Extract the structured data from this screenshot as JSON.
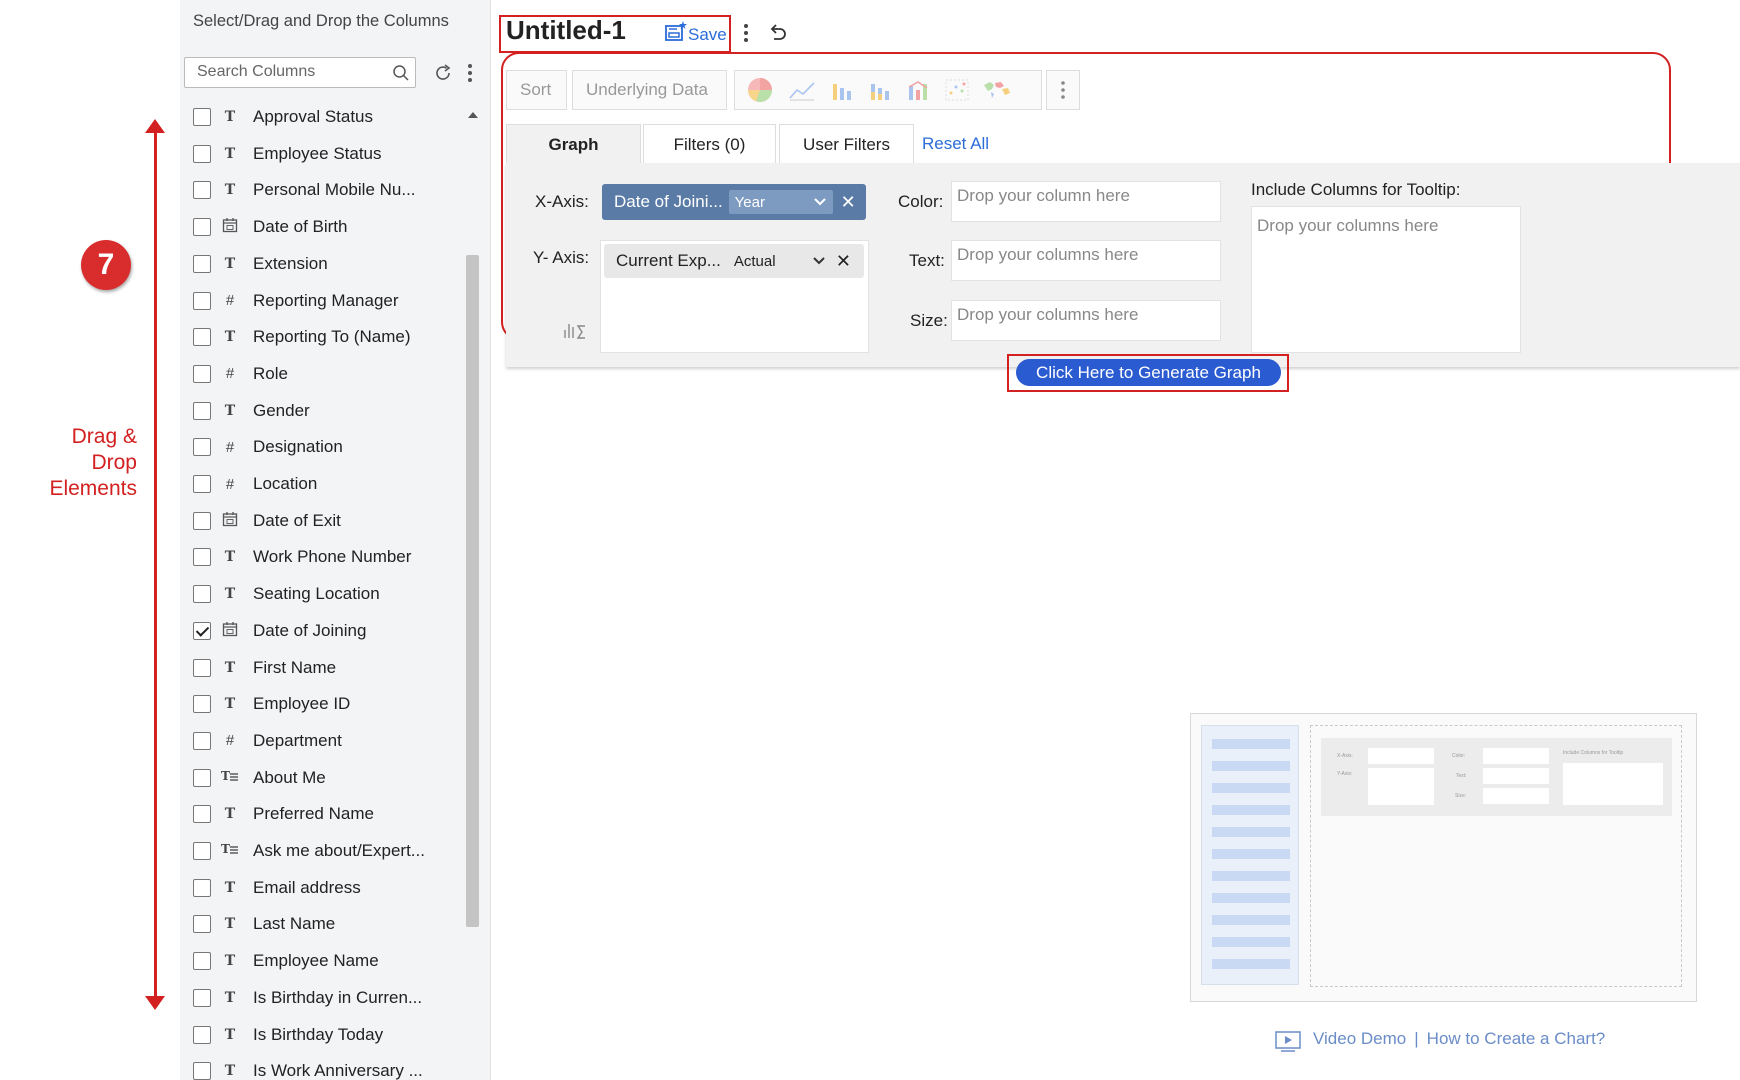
{
  "annotation": {
    "step_number": "7",
    "label_lines": [
      "Drag &",
      "Drop",
      "Elements"
    ]
  },
  "sidebar": {
    "title": "Select/Drag and Drop the Columns",
    "search_placeholder": "Search Columns",
    "columns": [
      {
        "label": "Approval Status",
        "type": "T",
        "checked": false
      },
      {
        "label": "Employee Status",
        "type": "T",
        "checked": false
      },
      {
        "label": "Personal Mobile Nu...",
        "type": "T",
        "checked": false
      },
      {
        "label": "Date of Birth",
        "type": "date",
        "checked": false
      },
      {
        "label": "Extension",
        "type": "T",
        "checked": false
      },
      {
        "label": "Reporting Manager",
        "type": "#",
        "checked": false
      },
      {
        "label": "Reporting To (Name)",
        "type": "T",
        "checked": false
      },
      {
        "label": "Role",
        "type": "#",
        "checked": false
      },
      {
        "label": "Gender",
        "type": "T",
        "checked": false
      },
      {
        "label": "Designation",
        "type": "#",
        "checked": false
      },
      {
        "label": "Location",
        "type": "#",
        "checked": false
      },
      {
        "label": "Date of Exit",
        "type": "date",
        "checked": false
      },
      {
        "label": "Work Phone Number",
        "type": "T",
        "checked": false
      },
      {
        "label": "Seating Location",
        "type": "T",
        "checked": false
      },
      {
        "label": "Date of Joining",
        "type": "date",
        "checked": true
      },
      {
        "label": "First Name",
        "type": "T",
        "checked": false
      },
      {
        "label": "Employee ID",
        "type": "T",
        "checked": false
      },
      {
        "label": "Department",
        "type": "#",
        "checked": false
      },
      {
        "label": "About Me",
        "type": "multiline",
        "checked": false
      },
      {
        "label": "Preferred Name",
        "type": "T",
        "checked": false
      },
      {
        "label": "Ask me about/Expert...",
        "type": "multiline",
        "checked": false
      },
      {
        "label": "Email address",
        "type": "T",
        "checked": false
      },
      {
        "label": "Last Name",
        "type": "T",
        "checked": false
      },
      {
        "label": "Employee Name",
        "type": "T",
        "checked": false
      },
      {
        "label": "Is Birthday in Curren...",
        "type": "T",
        "checked": false
      },
      {
        "label": "Is Birthday Today",
        "type": "T",
        "checked": false
      },
      {
        "label": "Is Work Anniversary ...",
        "type": "T",
        "checked": false
      }
    ]
  },
  "header": {
    "title": "Untitled-1",
    "save_label": "Save"
  },
  "toolbar": {
    "sort_label": "Sort",
    "underlying_label": "Underlying Data",
    "chart_icons": [
      "pie-chart-icon",
      "line-chart-icon",
      "bar-chart-icon",
      "stacked-bar-chart-icon",
      "combo-chart-icon",
      "scatter-chart-icon",
      "map-chart-icon"
    ]
  },
  "tabs": {
    "graph": "Graph",
    "filters": "Filters  (0)",
    "user_filters": "User Filters",
    "reset_all": "Reset All"
  },
  "config": {
    "x_axis_label": "X-Axis:",
    "x_axis_column": "Date of Joini...",
    "x_axis_agg": "Year",
    "y_axis_label": "Y- Axis:",
    "y_axis_column": "Current Exp...",
    "y_axis_agg": "Actual",
    "color_label": "Color:",
    "color_placeholder": "Drop your column here",
    "text_label": "Text:",
    "text_placeholder": "Drop your columns here",
    "size_label": "Size:",
    "size_placeholder": "Drop your columns here",
    "tooltip_label": "Include Columns for Tooltip:",
    "tooltip_placeholder": "Drop your columns here"
  },
  "generate_button": "Click Here to Generate Graph",
  "preview": {
    "x_axis": "X-Axis:",
    "y_axis": "Y-Axis:",
    "color": "Color:",
    "text": "Text:",
    "size": "Size:",
    "tooltip": "Include Columns for Tooltip"
  },
  "help_links": {
    "video_demo": "Video Demo",
    "separator": "|",
    "how_to": "How to Create a Chart?"
  },
  "colors": {
    "annotation_red": "#d32020",
    "link_blue": "#2b6cd8",
    "x_pill": "#5a7ba6",
    "generate_button": "#2b5bd1"
  }
}
